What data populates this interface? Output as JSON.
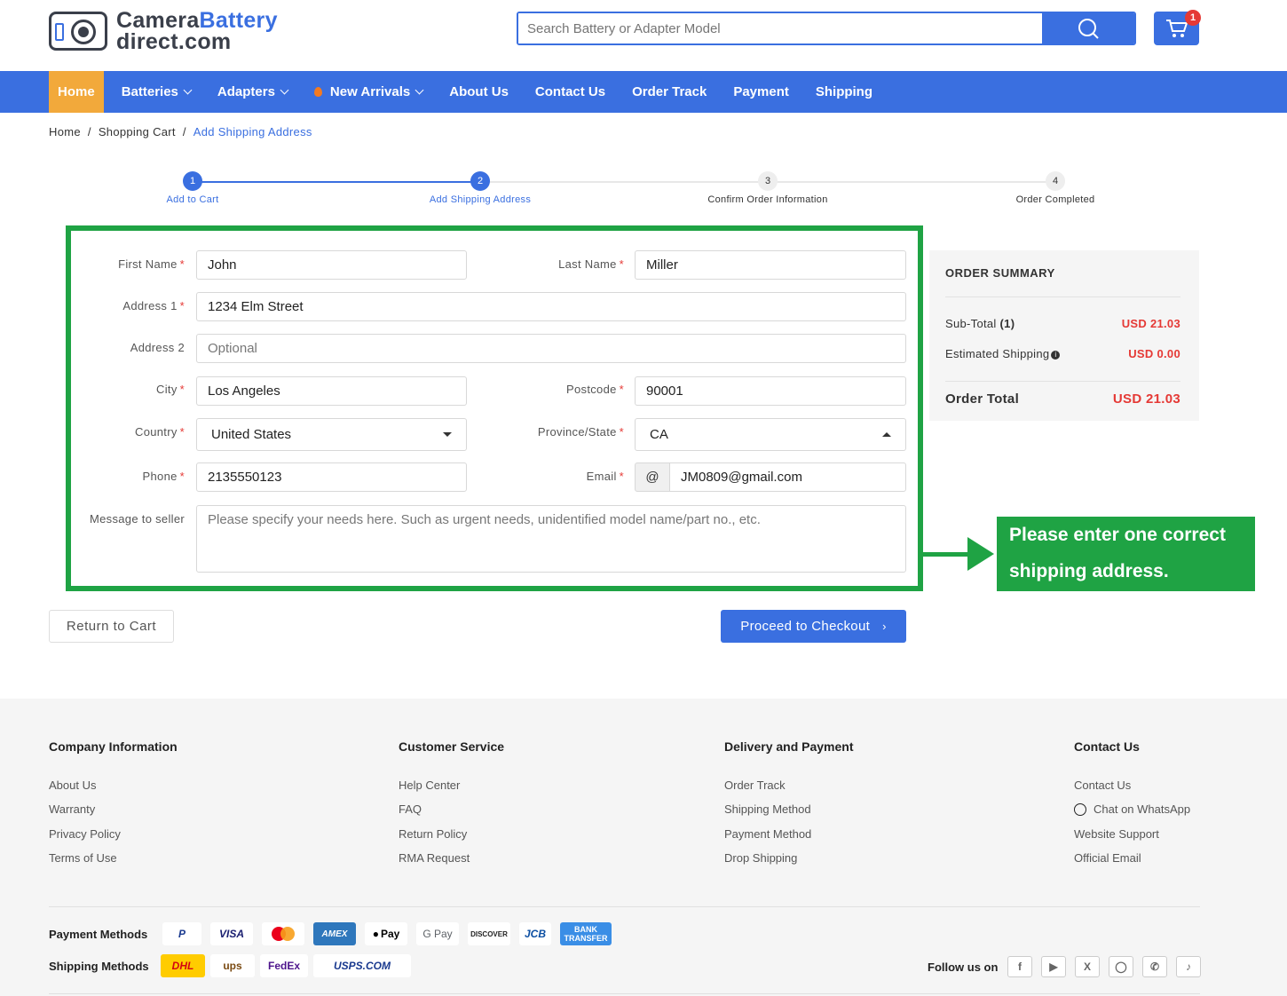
{
  "header": {
    "logo_text_1": "Camera",
    "logo_text_2": "Battery",
    "logo_text_3": "direct.com",
    "search_placeholder": "Search Battery or Adapter Model",
    "cart_count": "1"
  },
  "nav": {
    "home": "Home",
    "batteries": "Batteries",
    "adapters": "Adapters",
    "new_arrivals": "New Arrivals",
    "about": "About Us",
    "contact": "Contact Us",
    "order_track": "Order Track",
    "payment": "Payment",
    "shipping": "Shipping"
  },
  "breadcrumb": {
    "home": "Home",
    "sep1": "/",
    "cart": "Shopping Cart",
    "sep2": "/",
    "current": "Add Shipping Address"
  },
  "steps": [
    {
      "num": "1",
      "label": "Add to Cart"
    },
    {
      "num": "2",
      "label": "Add Shipping Address"
    },
    {
      "num": "3",
      "label": "Confirm Order Information"
    },
    {
      "num": "4",
      "label": "Order Completed"
    }
  ],
  "form": {
    "first_name_label": "First Name",
    "first_name": "John",
    "last_name_label": "Last Name",
    "last_name": "Miller",
    "address1_label": "Address 1",
    "address1": "1234 Elm Street",
    "address2_label": "Address 2",
    "address2_placeholder": "Optional",
    "city_label": "City",
    "city": "Los Angeles",
    "postcode_label": "Postcode",
    "postcode": "90001",
    "country_label": "Country",
    "country": "United States",
    "state_label": "Province/State",
    "state": "CA",
    "phone_label": "Phone",
    "phone": "2135550123",
    "email_label": "Email",
    "email_prefix": "@",
    "email": "JM0809@gmail.com",
    "message_label": "Message to seller",
    "message_placeholder": "Please specify your needs here. Such as urgent needs, unidentified model name/part no., etc.",
    "required_mark": "*"
  },
  "summary": {
    "title": "ORDER SUMMARY",
    "subtotal_label": "Sub-Total",
    "subtotal_count": "(1)",
    "subtotal_value": "USD 21.03",
    "shipping_label": "Estimated Shipping",
    "shipping_value": "USD 0.00",
    "total_label": "Order Total",
    "total_value": "USD 21.03"
  },
  "callout": {
    "line1": "Please enter one correct",
    "line2": "shipping address."
  },
  "buttons": {
    "return": "Return to Cart",
    "proceed": "Proceed to Checkout"
  },
  "footer": {
    "company": {
      "title": "Company Information",
      "links": [
        "About Us",
        "Warranty",
        "Privacy Policy",
        "Terms of Use"
      ]
    },
    "service": {
      "title": "Customer Service",
      "links": [
        "Help Center",
        "FAQ",
        "Return Policy",
        "RMA Request"
      ]
    },
    "delivery": {
      "title": "Delivery and Payment",
      "links": [
        "Order Track",
        "Shipping Method",
        "Payment Method",
        "Drop Shipping"
      ]
    },
    "contact": {
      "title": "Contact Us",
      "links": [
        "Contact Us",
        "Chat on WhatsApp",
        "Website Support",
        "Official Email"
      ]
    },
    "payment_label": "Payment Methods",
    "payment_methods": [
      "P",
      "VISA",
      "",
      "AMEX",
      "Pay",
      "G Pay",
      "DISCOVER",
      "JCB",
      "BANK TRANSFER"
    ],
    "shipping_label": "Shipping Methods",
    "shipping_methods": [
      "DHL",
      "ups",
      "FedEx",
      "USPS.COM"
    ],
    "follow_label": "Follow us on",
    "social_icons": [
      "facebook-icon",
      "youtube-icon",
      "x-icon",
      "instagram-icon",
      "whatsapp-icon",
      "tiktok-icon"
    ]
  },
  "colors": {
    "primary": "#3a6fe0",
    "home_tab": "#f2a93b",
    "highlight_green": "#1fa344",
    "price_red": "#e53935"
  }
}
